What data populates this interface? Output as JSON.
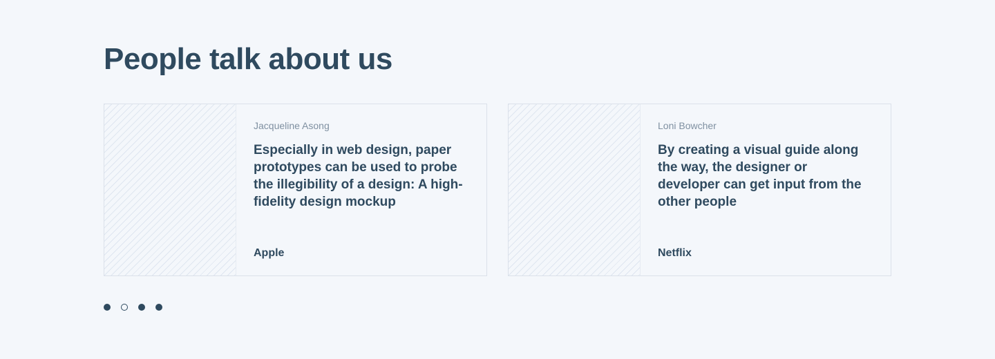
{
  "section": {
    "title": "People talk about us"
  },
  "testimonials": [
    {
      "author": "Jacqueline Asong",
      "quote": "Especially in web design, paper prototypes can be used to probe the illegibility of a design: A high-fidelity design mockup",
      "company": "Apple"
    },
    {
      "author": "Loni Bowcher",
      "quote": "By creating a visual guide along the way, the designer or developer can get input from the other people",
      "company": "Netflix"
    }
  ],
  "pagination": {
    "total_dots": 4,
    "active_states": [
      true,
      false,
      true,
      true
    ]
  }
}
